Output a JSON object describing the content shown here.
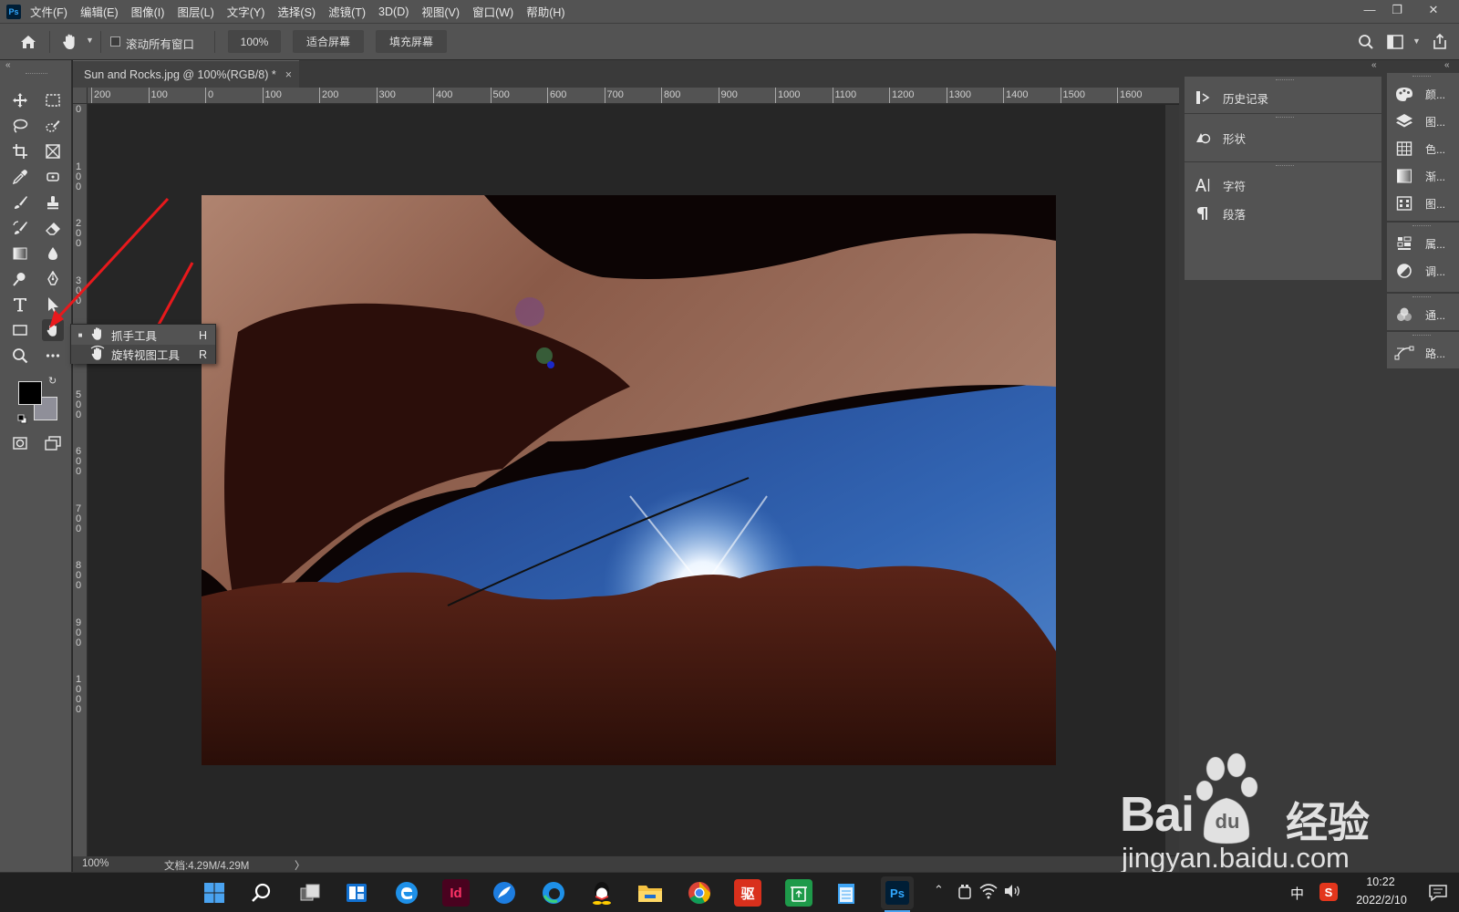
{
  "app": {
    "logo_text": "Ps"
  },
  "menubar": {
    "items": [
      "文件(F)",
      "编辑(E)",
      "图像(I)",
      "图层(L)",
      "文字(Y)",
      "选择(S)",
      "滤镜(T)",
      "3D(D)",
      "视图(V)",
      "窗口(W)",
      "帮助(H)"
    ]
  },
  "options": {
    "scroll_all_label": "滚动所有窗口",
    "zoom_value": "100%",
    "fit_screen": "适合屏幕",
    "fill_screen": "填充屏幕"
  },
  "document": {
    "tab_title": "Sun and Rocks.jpg @ 100%(RGB/8) *",
    "close_glyph": "×"
  },
  "ruler": {
    "h_labels": [
      "200",
      "100",
      "0",
      "100",
      "200",
      "300",
      "400",
      "500",
      "600",
      "700",
      "800",
      "900",
      "1000",
      "1100",
      "1200",
      "1300",
      "1400",
      "1500",
      "1600"
    ],
    "v_labels": [
      "0",
      "1\n0\n0",
      "2\n0\n0",
      "3\n0\n0",
      "4\n0\n0",
      "5\n0\n0",
      "6\n0\n0",
      "7\n0\n0",
      "8\n0\n0",
      "9\n0\n0",
      "1\n0\n0\n0"
    ]
  },
  "flyout": {
    "items": [
      {
        "label": "抓手工具",
        "shortcut": "H",
        "icon": "hand-icon",
        "active": true
      },
      {
        "label": "旋转视图工具",
        "shortcut": "R",
        "icon": "rotate-view-icon",
        "active": false
      }
    ]
  },
  "status": {
    "zoom": "100%",
    "doc_size": "文档:4.29M/4.29M",
    "arrow": "〉"
  },
  "panels_mid": [
    {
      "label": "历史记录",
      "icon": "history-icon"
    },
    {
      "label": "形状",
      "icon": "shapes-icon"
    },
    {
      "label": "字符",
      "icon": "character-icon"
    },
    {
      "label": "段落",
      "icon": "paragraph-icon"
    }
  ],
  "panels_right": [
    {
      "label": "颜...",
      "icon": "color-icon"
    },
    {
      "label": "图...",
      "icon": "layers-icon"
    },
    {
      "label": "色...",
      "icon": "swatches-icon"
    },
    {
      "label": "渐...",
      "icon": "gradient-icon"
    },
    {
      "label": "图...",
      "icon": "patterns-icon"
    },
    {
      "label": "属...",
      "icon": "properties-icon"
    },
    {
      "label": "调...",
      "icon": "adjustments-icon"
    },
    {
      "label": "通...",
      "icon": "channels-icon"
    },
    {
      "label": "路...",
      "icon": "paths-icon"
    }
  ],
  "taskbar": {
    "time": "10:22",
    "date": "2022/2/10",
    "ime": "中",
    "apps": [
      "windows-start",
      "search",
      "task-view",
      "widgets",
      "edge-legacy",
      "indesign",
      "feather-app",
      "edge",
      "qq",
      "file-explorer",
      "chrome",
      "dict-app",
      "recycle-app",
      "notepad",
      "photoshop"
    ],
    "app_labels": {
      "indesign": "Id",
      "photoshop": "Ps",
      "dict-app": "驱"
    }
  },
  "watermark": {
    "brand": "Bai",
    "brand_tail": "经验",
    "paw_text": "du",
    "url": "jingyan.baidu.com"
  },
  "colors": {
    "accent_blue": "#31a8ff",
    "arrow_red": "#e8191c",
    "ui_dark": "#535353"
  }
}
